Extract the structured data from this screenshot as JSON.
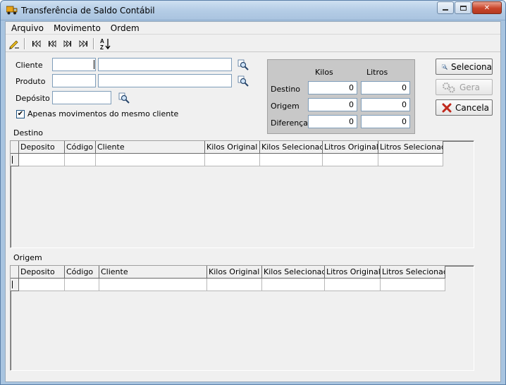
{
  "window": {
    "title": "Transferência de Saldo Contábil",
    "icon": "truck-icon"
  },
  "menu": {
    "items": [
      "Arquivo",
      "Movimento",
      "Ordem"
    ]
  },
  "toolbar": {
    "icons": [
      "edit-pencil-icon",
      "first-record-icon",
      "previous-record-icon",
      "next-record-icon",
      "last-record-icon",
      "sort-az-icon"
    ]
  },
  "filters": {
    "cliente_label": "Cliente",
    "produto_label": "Produto",
    "deposito_label": "Depósito",
    "same_client_label": "Apenas movimentos do mesmo cliente",
    "same_client_checked": true
  },
  "totals": {
    "kilos_header": "Kilos",
    "litros_header": "Litros",
    "rows": [
      {
        "label": "Destino",
        "kilos": "0",
        "litros": "0"
      },
      {
        "label": "Origem",
        "kilos": "0",
        "litros": "0"
      },
      {
        "label": "Diferença",
        "kilos": "0",
        "litros": "0"
      }
    ]
  },
  "buttons": {
    "seleciona": "Seleciona",
    "gera": "Gera",
    "cancela": "Cancela"
  },
  "destino": {
    "label": "Destino",
    "columns": [
      "Deposito",
      "Código",
      "Cliente",
      "Kilos Original",
      "Kilos Selecionado",
      "Litros Original",
      "Litros Selecionado"
    ]
  },
  "origem": {
    "label": "Origem",
    "columns": [
      "Deposito",
      "Código",
      "Cliente",
      "Kilos Original",
      "Kilos Selecionado",
      "Litros Original",
      "Litros Selecionado"
    ]
  },
  "colors": {
    "titlebar": "#b5cde6",
    "cancel_x": "#c0281c"
  }
}
